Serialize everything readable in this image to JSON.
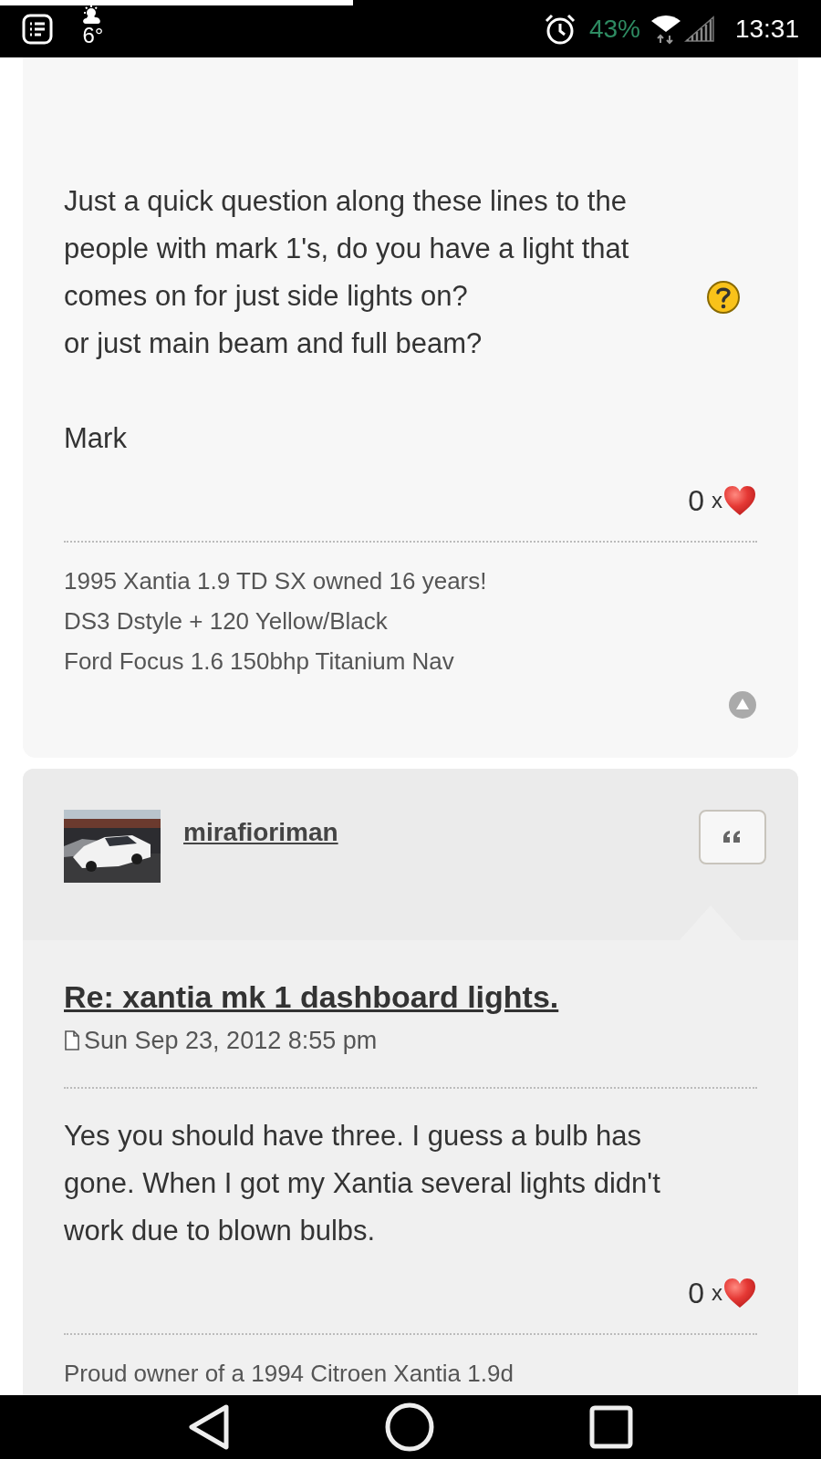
{
  "status_bar": {
    "temperature": "6°",
    "battery": "43%",
    "time": "13:31"
  },
  "page_load_progress": {
    "level": 0.43
  },
  "posts": [
    {
      "paragraphs": [
        [
          {
            "text": "Just a quick question along these lines to the people with mark 1's, do you have a light that comes on for just side lights on?",
            "question_icon": true
          },
          {
            "text": "or just main beam and full beam?",
            "question_icon": false
          }
        ],
        [
          {
            "text": "Mark",
            "question_icon": false
          }
        ]
      ],
      "likes": {
        "count": "0",
        "times": "x"
      },
      "signature": [
        "1995 Xantia 1.9 TD SX owned 16 years!",
        "DS3 Dstyle + 120 Yellow/Black",
        "Ford Focus 1.6 150bhp Titanium Nav"
      ],
      "back_to_top": true
    },
    {
      "author": "mirafioriman",
      "title": "Re: xantia mk 1 dashboard lights.",
      "date": "Sun Sep 23, 2012 8:55 pm",
      "paragraphs": [
        [
          {
            "text": "Yes you should have three. I guess a bulb has gone. When I got my Xantia several lights didn't work due to blown bulbs.",
            "question_icon": false
          }
        ]
      ],
      "likes": {
        "count": "0",
        "times": "x"
      },
      "signature": [
        "Proud owner of a 1994 Citroen Xantia 1.9d"
      ],
      "back_to_top": false
    }
  ]
}
